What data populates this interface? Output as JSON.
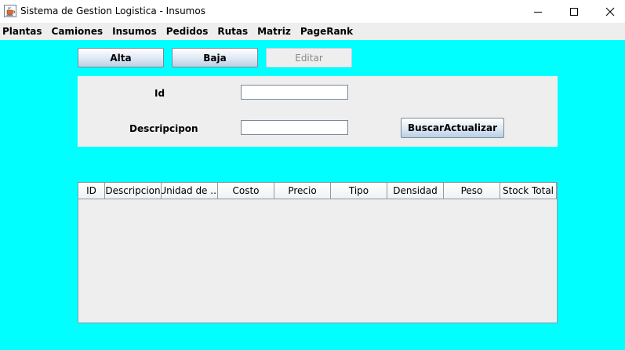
{
  "window": {
    "title": "Sistema de Gestion Logistica - Insumos"
  },
  "menu": [
    "Plantas",
    "Camiones",
    "Insumos",
    "Pedidos",
    "Rutas",
    "Matriz",
    "PageRank"
  ],
  "toolbar": {
    "alta": "Alta",
    "baja": "Baja",
    "editar": "Editar"
  },
  "form": {
    "id_label": "Id",
    "id_value": "",
    "descripcion_label": "Descripcipon",
    "descripcion_value": "",
    "buscar_label": "BuscarActualizar"
  },
  "table": {
    "columns": [
      "ID",
      "Descripcion",
      "Unidad de ...",
      "Costo",
      "Precio",
      "Tipo",
      "Densidad",
      "Peso",
      "Stock Total"
    ],
    "rows": []
  },
  "colors": {
    "background": "#00ffff",
    "panel": "#eeeeee"
  },
  "icons": {
    "app": "java-coffee-cup-icon",
    "minimize": "minimize-icon",
    "maximize": "maximize-icon",
    "close": "close-icon"
  }
}
